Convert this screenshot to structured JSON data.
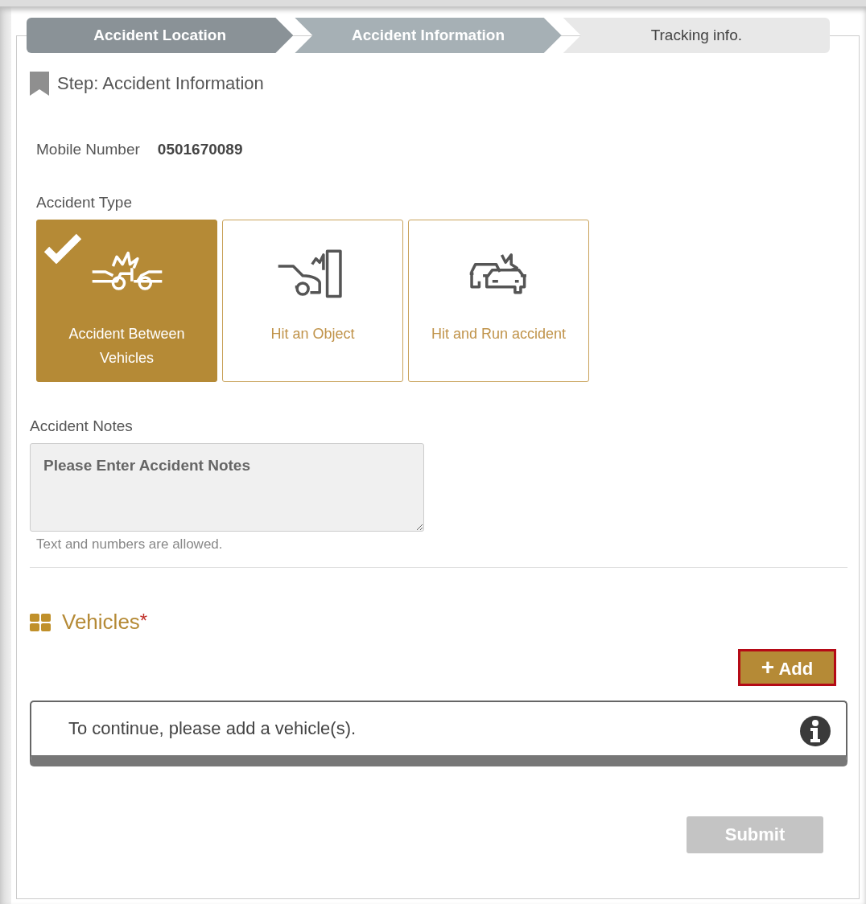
{
  "steps": [
    {
      "label": "Accident Location",
      "completed": true,
      "selected": false
    },
    {
      "label": "Accident Information",
      "completed": false,
      "selected": true
    },
    {
      "label": "Tracking info.",
      "completed": false,
      "selected": false
    }
  ],
  "step_heading": "Step: Accident Information",
  "mobile": {
    "label": "Mobile Number",
    "value": "0501670089"
  },
  "accident_type": {
    "label": "Accident Type",
    "options": [
      {
        "label": "Accident Between Vehicles",
        "kind": "vehicles",
        "selected": true
      },
      {
        "label": "Hit an Object",
        "kind": "object",
        "selected": false
      },
      {
        "label": "Hit and Run accident",
        "kind": "hit-run",
        "selected": false
      }
    ]
  },
  "notes": {
    "label": "Accident Notes",
    "placeholder": "Please Enter Accident Notes",
    "hint": "Text and numbers are allowed."
  },
  "vehicles": {
    "title": "Vehicles",
    "required_mark": "*",
    "add_button": {
      "icon": "+",
      "label": "Add",
      "highlighted": true
    },
    "message": "To continue, please add a vehicle(s)."
  },
  "submit": {
    "label": "Submit",
    "disabled": true
  }
}
